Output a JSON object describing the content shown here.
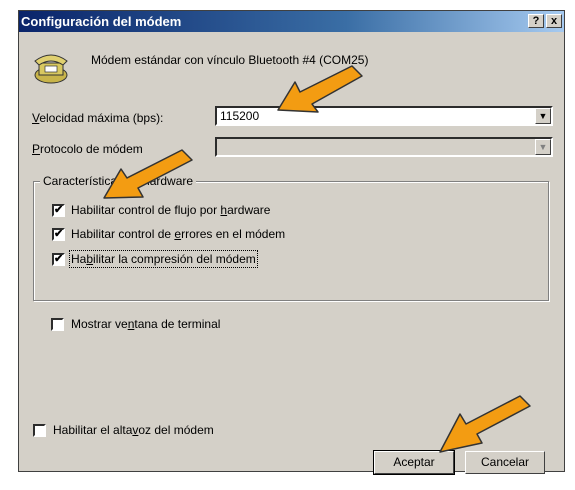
{
  "window": {
    "title": "Configuración del módem",
    "help_glyph": "?",
    "close_glyph": "x"
  },
  "modem_name": "Módem estándar con vínculo Bluetooth #4 (COM25)",
  "speed": {
    "label": "Velocidad máxima (bps):",
    "value": "115200"
  },
  "protocol": {
    "label": "Protocolo de módem",
    "value": ""
  },
  "hardware_group": {
    "legend": "Características de hardware",
    "options": [
      {
        "label": "Habilitar control de flujo por hardware",
        "checked": true
      },
      {
        "label": "Habilitar control de errores en el módem",
        "checked": true
      },
      {
        "label": "Habilitar la compresión del módem",
        "checked": true
      }
    ]
  },
  "terminal": {
    "label": "Mostrar ventana de terminal",
    "checked": false
  },
  "speaker": {
    "label": "Habilitar el altavoz del módem",
    "checked": false
  },
  "buttons": {
    "ok": "Aceptar",
    "cancel": "Cancelar"
  },
  "icons": [
    "modem-phone-icon",
    "chevron-down-icon",
    "annotation-arrow"
  ],
  "colors": {
    "titlebar_start": "#0a246a",
    "titlebar_end": "#a6caf0",
    "dialog_bg": "#d4d0c8",
    "arrow": "#f39c12"
  }
}
